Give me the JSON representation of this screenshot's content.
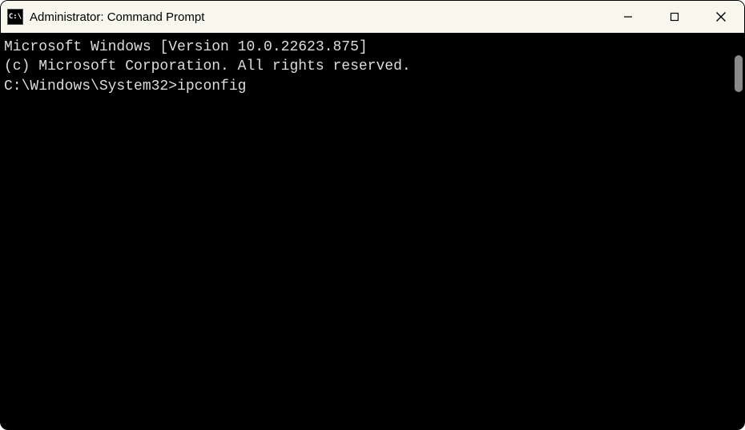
{
  "titlebar": {
    "title": "Administrator: Command Prompt"
  },
  "terminal": {
    "line1": "Microsoft Windows [Version 10.0.22623.875]",
    "line2": "(c) Microsoft Corporation. All rights reserved.",
    "blank": "",
    "prompt": "C:\\Windows\\System32>",
    "command": "ipconfig"
  }
}
